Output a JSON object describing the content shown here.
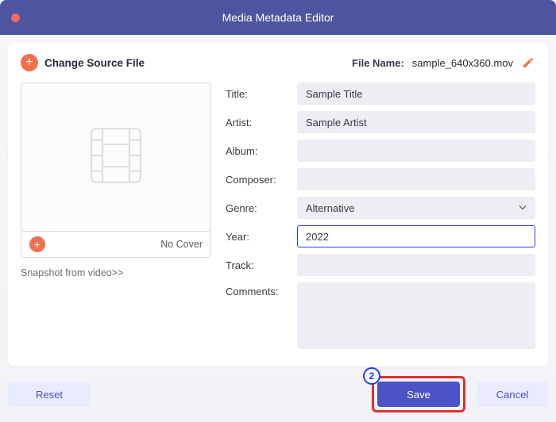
{
  "window": {
    "title": "Media Metadata Editor"
  },
  "header": {
    "change_source_label": "Change Source File",
    "file_name_label": "File Name:",
    "file_name_value": "sample_640x360.mov"
  },
  "cover": {
    "no_cover_label": "No Cover",
    "snapshot_label": "Snapshot from video>>"
  },
  "form": {
    "title_label": "Title:",
    "title_value": "Sample Title",
    "artist_label": "Artist:",
    "artist_value": "Sample Artist",
    "album_label": "Album:",
    "album_value": "",
    "composer_label": "Composer:",
    "composer_value": "",
    "genre_label": "Genre:",
    "genre_value": "Alternative",
    "year_label": "Year:",
    "year_value": "2022",
    "track_label": "Track:",
    "track_value": "",
    "comments_label": "Comments:",
    "comments_value": ""
  },
  "footer": {
    "reset_label": "Reset",
    "save_label": "Save",
    "cancel_label": "Cancel"
  },
  "annotation": {
    "step_number": "2"
  }
}
